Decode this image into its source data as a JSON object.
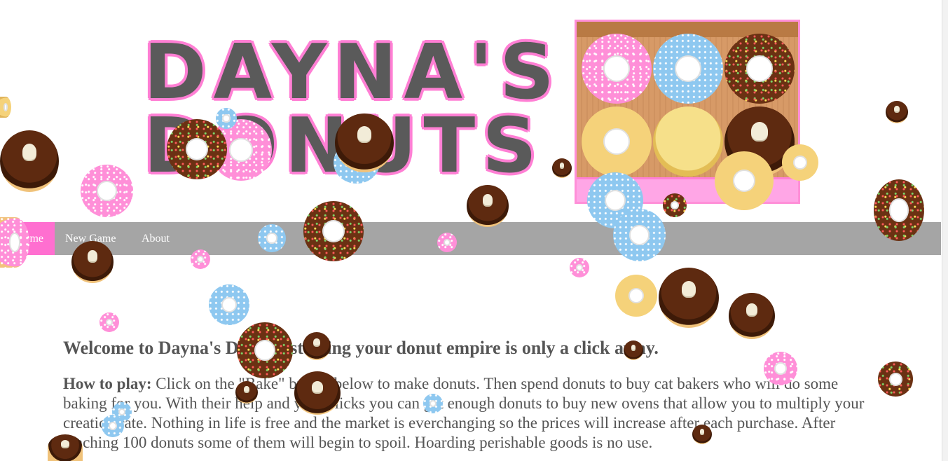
{
  "window": {
    "title": "Dayna's Donuts"
  },
  "header": {
    "logo_line1": "DAYNA'S",
    "logo_line2": "DONUTS",
    "box_colors": {
      "frame": "#ff8fd8",
      "cardboard": "#d89a66",
      "front": "#ffa6e6"
    }
  },
  "nav": {
    "items": [
      {
        "label": "Home"
      },
      {
        "label": "New Game"
      },
      {
        "label": "About"
      }
    ],
    "active_color": "#ff6fd0",
    "bar_color": "#a5a5a5"
  },
  "content": {
    "welcome": "Welcome to Dayna's Donuts, starting your donut empire is only a click away.",
    "howto_label": "How to play:",
    "howto_text": " Click on the \"Bake\" button below to make donuts. Then spend donuts to buy cat bakers who will do some baking for you. With their help and your clicks you can get enough donuts to buy new ovens that allow you to multiply your creation rate. Nothing in life is free and the market is everchanging so the prices will increase after each purchase. After reaching 100 donuts some of them will begin to spoil. Hoarding perishable goods is no use."
  },
  "icons": [
    "pink-donut-icon",
    "blue-donut-icon",
    "chocolate-sprinkle-donut-icon",
    "yellow-donut-icon",
    "cream-filled-donut-icon",
    "cat-baker-icon"
  ]
}
